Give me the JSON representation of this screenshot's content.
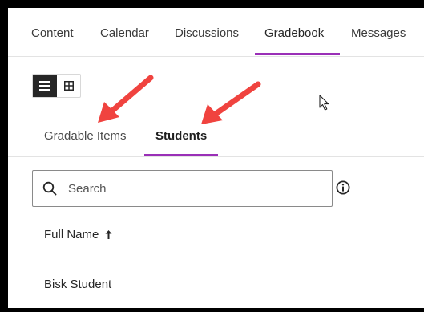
{
  "nav": {
    "tabs": [
      {
        "label": "Content"
      },
      {
        "label": "Calendar"
      },
      {
        "label": "Discussions"
      },
      {
        "label": "Gradebook"
      },
      {
        "label": "Messages"
      }
    ],
    "active_tab": "Gradebook"
  },
  "view_toggle": {
    "options": [
      "list-icon",
      "grid-icon"
    ],
    "selected": "list-icon"
  },
  "subtabs": {
    "items": [
      {
        "label": "Gradable Items"
      },
      {
        "label": "Students"
      }
    ],
    "active": "Students"
  },
  "search": {
    "placeholder": "Search",
    "value": ""
  },
  "table": {
    "column_header": "Full Name",
    "sort": "ascending",
    "rows": [
      {
        "name": "Bisk Student"
      }
    ]
  },
  "colors": {
    "accent": "#9a2fb7",
    "annotation_arrow": "#f0433f"
  }
}
